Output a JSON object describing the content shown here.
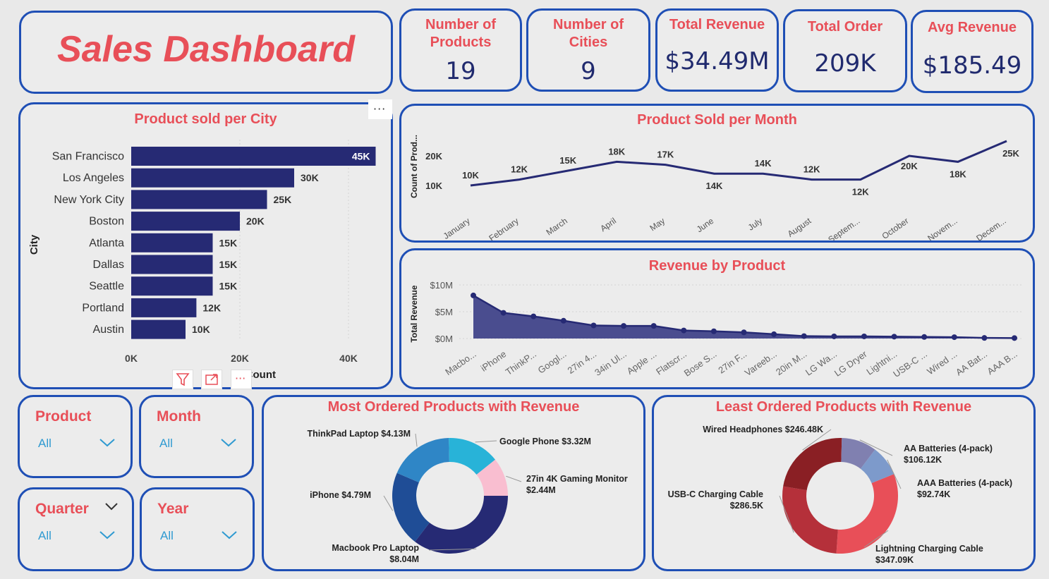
{
  "dashboard": {
    "title": "Sales Dashboard"
  },
  "kpis": [
    {
      "label": "Number of Products",
      "value": "19"
    },
    {
      "label": "Number of Cities",
      "value": "9"
    },
    {
      "label": "Total Revenue",
      "value": "$34.49M"
    },
    {
      "label": "Total Order",
      "value": "209K"
    },
    {
      "label": "Avg Revenue",
      "value": "$185.49"
    }
  ],
  "slicers": [
    {
      "label": "Product",
      "value": "All"
    },
    {
      "label": "Month",
      "value": "All"
    },
    {
      "label": "Quarter",
      "value": "All"
    },
    {
      "label": "Year",
      "value": "All"
    }
  ],
  "colors": {
    "accent": "#e84f58",
    "navy": "#262a74",
    "border": "#1f4fb5"
  },
  "chart_data": [
    {
      "id": "city",
      "type": "bar",
      "title": "Product sold per City",
      "ylabel": "City",
      "xlabel": "Count",
      "categories": [
        "San Francisco",
        "Los Angeles",
        "New York City",
        "Boston",
        "Atlanta",
        "Dallas",
        "Seattle",
        "Portland",
        "Austin"
      ],
      "values": [
        45000,
        30000,
        25000,
        20000,
        15000,
        15000,
        15000,
        12000,
        10000
      ],
      "data_labels": [
        "45K",
        "30K",
        "25K",
        "20K",
        "15K",
        "15K",
        "15K",
        "12K",
        "10K"
      ],
      "xticks": [
        "0K",
        "20K",
        "40K"
      ],
      "xlim": [
        0,
        46000
      ]
    },
    {
      "id": "month",
      "type": "line",
      "title": "Product Sold per Month",
      "ylabel": "Count of Prod...",
      "categories": [
        "January",
        "February",
        "March",
        "April",
        "May",
        "June",
        "July",
        "August",
        "Septem...",
        "October",
        "Novem...",
        "Decem..."
      ],
      "values": [
        10000,
        12000,
        15000,
        18000,
        17000,
        14000,
        14000,
        12000,
        12000,
        20000,
        18000,
        25000
      ],
      "data_labels": [
        "10K",
        "12K",
        "15K",
        "18K",
        "17K",
        "14K",
        "14K",
        "12K",
        "12K",
        "20K",
        "18K",
        "25K"
      ],
      "yticks": [
        "10K",
        "20K"
      ],
      "ylim": [
        8000,
        26000
      ]
    },
    {
      "id": "revenue",
      "type": "area",
      "title": "Revenue by Product",
      "ylabel": "Total Revenue",
      "categories": [
        "Macbo...",
        "iPhone",
        "ThinkP...",
        "Googl...",
        "27in 4...",
        "34in Ul...",
        "Apple ...",
        "Flatscr...",
        "Bose S...",
        "27in F...",
        "Vareeb...",
        "20in M...",
        "LG Wa...",
        "LG Dryer",
        "Lightni...",
        "USB-C ...",
        "Wired ...",
        "AA Bat...",
        "AAA B..."
      ],
      "values": [
        8.04,
        4.79,
        4.13,
        3.32,
        2.44,
        2.35,
        2.35,
        1.5,
        1.35,
        1.15,
        0.8,
        0.45,
        0.4,
        0.4,
        0.35,
        0.29,
        0.25,
        0.11,
        0.09
      ],
      "yticks": [
        "$0M",
        "$5M",
        "$10M"
      ],
      "ylim": [
        0,
        10
      ]
    },
    {
      "id": "most",
      "type": "pie",
      "title": "Most Ordered Products with Revenue",
      "labels": [
        "Macbook Pro Laptop $8.04M",
        "iPhone $4.79M",
        "ThinkPad Laptop $4.13M",
        "Google Phone $3.32M",
        "27in 4K Gaming Monitor $2.44M"
      ],
      "values": [
        8.04,
        4.79,
        4.13,
        3.32,
        2.44
      ],
      "colors": [
        "#262a74",
        "#1f4d96",
        "#2f86c6",
        "#28b3d8",
        "#f9bed0"
      ]
    },
    {
      "id": "least",
      "type": "pie",
      "title": "Least Ordered Products with Revenue",
      "labels": [
        "Lightning Charging Cable $347.09K",
        "USB-C Charging Cable $286.5K",
        "Wired Headphones $246.48K",
        "AA Batteries (4-pack) $106.12K",
        "AAA Batteries (4-pack) $92.74K"
      ],
      "values": [
        347.09,
        286.5,
        246.48,
        106.12,
        92.74
      ],
      "colors": [
        "#e84f58",
        "#b5303a",
        "#8a1f24",
        "#8080b0",
        "#7d9acb"
      ]
    }
  ]
}
